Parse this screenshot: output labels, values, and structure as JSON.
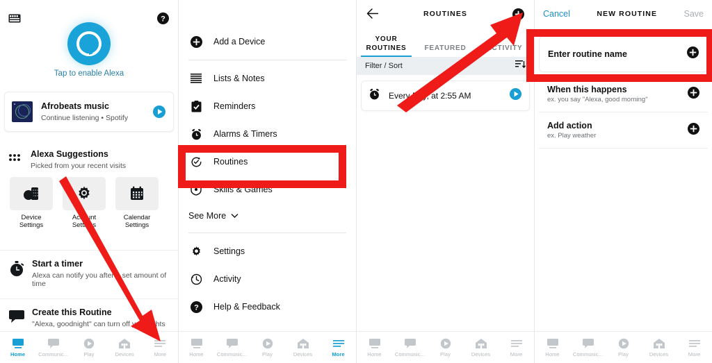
{
  "accent_blue": "#1a9fd4",
  "annotation_red": "#ee1b18",
  "panel1": {
    "icons": {
      "keyboard": "keyboard-icon",
      "help": "help-circle-icon",
      "alexa_ring": "alexa-ring-icon"
    },
    "tap_label": "Tap to enable Alexa",
    "now_playing": {
      "title": "Afrobeats music",
      "subtitle": "Continue listening • Spotify",
      "play_icon": "play-circle-icon",
      "art_icon": "album-art"
    },
    "suggestions": {
      "title": "Alexa Suggestions",
      "subtitle": "Picked from your recent visits",
      "grid_icon": "grid-dots-icon",
      "tiles": [
        {
          "label": "Device\nSettings",
          "label_line1": "Device",
          "label_line2": "Settings",
          "icon": "devices-icon"
        },
        {
          "label": "Account\nSettings",
          "label_line1": "Account",
          "label_line2": "Settings",
          "icon": "gear-icon"
        },
        {
          "label": "Calendar\nSettings",
          "label_line1": "Calendar",
          "label_line2": "Settings",
          "icon": "calendar-icon"
        }
      ]
    },
    "timer": {
      "title": "Start a timer",
      "subtitle": "Alexa can notify you after a set amount of time",
      "icon": "stopwatch-icon"
    },
    "routine": {
      "title": "Create this Routine",
      "subtitle": "\"Alexa, goodnight\" can turn off your lights",
      "icon": "speech-bubble-icon"
    },
    "nav": {
      "active": "Home",
      "items": [
        {
          "label": "Home",
          "icon": "home-icon"
        },
        {
          "label": "Communic...",
          "icon": "chat-bubble-icon"
        },
        {
          "label": "Play",
          "icon": "play-circle-icon"
        },
        {
          "label": "Devices",
          "icon": "devices-home-icon"
        },
        {
          "label": "More",
          "icon": "hamburger-icon"
        }
      ]
    }
  },
  "panel2": {
    "menu": [
      {
        "label": "Add a Device",
        "icon": "plus-circle-icon"
      },
      {
        "label": "Lists & Notes",
        "icon": "list-lines-icon"
      },
      {
        "label": "Reminders",
        "icon": "clipboard-check-icon"
      },
      {
        "label": "Alarms & Timers",
        "icon": "alarm-clock-icon"
      },
      {
        "label": "Routines",
        "icon": "routines-refresh-check-icon"
      },
      {
        "label": "Skills & Games",
        "icon": "skills-badge-icon"
      }
    ],
    "see_more": {
      "label": "See More",
      "icon": "chevron-down-icon"
    },
    "footer_menu": [
      {
        "label": "Settings",
        "icon": "gear-icon"
      },
      {
        "label": "Activity",
        "icon": "clock-back-icon"
      },
      {
        "label": "Help & Feedback",
        "icon": "help-circle-icon"
      }
    ],
    "nav": {
      "active": "More",
      "items": [
        {
          "label": "Home",
          "icon": "home-icon"
        },
        {
          "label": "Communic...",
          "icon": "chat-bubble-icon"
        },
        {
          "label": "Play",
          "icon": "play-circle-icon"
        },
        {
          "label": "Devices",
          "icon": "devices-home-icon"
        },
        {
          "label": "More",
          "icon": "hamburger-icon"
        }
      ]
    }
  },
  "panel3": {
    "header": {
      "title": "ROUTINES",
      "back_icon": "back-arrow-icon",
      "add_icon": "plus-circle-icon"
    },
    "tabs": [
      {
        "label_line1": "YOUR",
        "label_line2": "ROUTINES",
        "active": true
      },
      {
        "label_line1": "FEATURED",
        "label_line2": "",
        "active": false
      },
      {
        "label_line1": "ACTIVITY",
        "label_line2": "",
        "active": false
      }
    ],
    "filter_bar": {
      "label": "Filter / Sort",
      "icon": "sort-descending-icon"
    },
    "routines": [
      {
        "title": "Every Day, at 2:55 AM",
        "icon": "alarm-clock-icon",
        "play_icon": "play-circle-icon"
      }
    ],
    "nav": {
      "active": "",
      "items": [
        {
          "label": "Home",
          "icon": "home-icon"
        },
        {
          "label": "Communic...",
          "icon": "chat-bubble-icon"
        },
        {
          "label": "Play",
          "icon": "play-circle-icon"
        },
        {
          "label": "Devices",
          "icon": "devices-home-icon"
        },
        {
          "label": "More",
          "icon": "hamburger-icon"
        }
      ]
    }
  },
  "panel4": {
    "header": {
      "cancel": "Cancel",
      "title": "NEW ROUTINE",
      "save": "Save"
    },
    "rows": [
      {
        "title": "Enter routine name",
        "subtitle": "",
        "add_icon": "plus-circle-icon"
      },
      {
        "title": "When this happens",
        "subtitle": "ex. you say \"Alexa, good morning\"",
        "add_icon": "plus-circle-icon"
      },
      {
        "title": "Add action",
        "subtitle": "ex. Play weather",
        "add_icon": "plus-circle-icon"
      }
    ],
    "nav": {
      "active": "",
      "items": [
        {
          "label": "Home",
          "icon": "home-icon"
        },
        {
          "label": "Communic...",
          "icon": "chat-bubble-icon"
        },
        {
          "label": "Play",
          "icon": "play-circle-icon"
        },
        {
          "label": "Devices",
          "icon": "devices-home-icon"
        },
        {
          "label": "More",
          "icon": "hamburger-icon"
        }
      ]
    }
  },
  "annotations": {
    "boxes": [
      {
        "name": "routines-menu-highlight",
        "target": "Routines"
      },
      {
        "name": "enter-routine-name-highlight",
        "target": "Enter routine name"
      }
    ],
    "arrows": [
      {
        "name": "arrow-to-more-tab",
        "points_to": "More"
      },
      {
        "name": "arrow-to-add-routine",
        "points_to": "plus-circle-icon"
      }
    ]
  }
}
